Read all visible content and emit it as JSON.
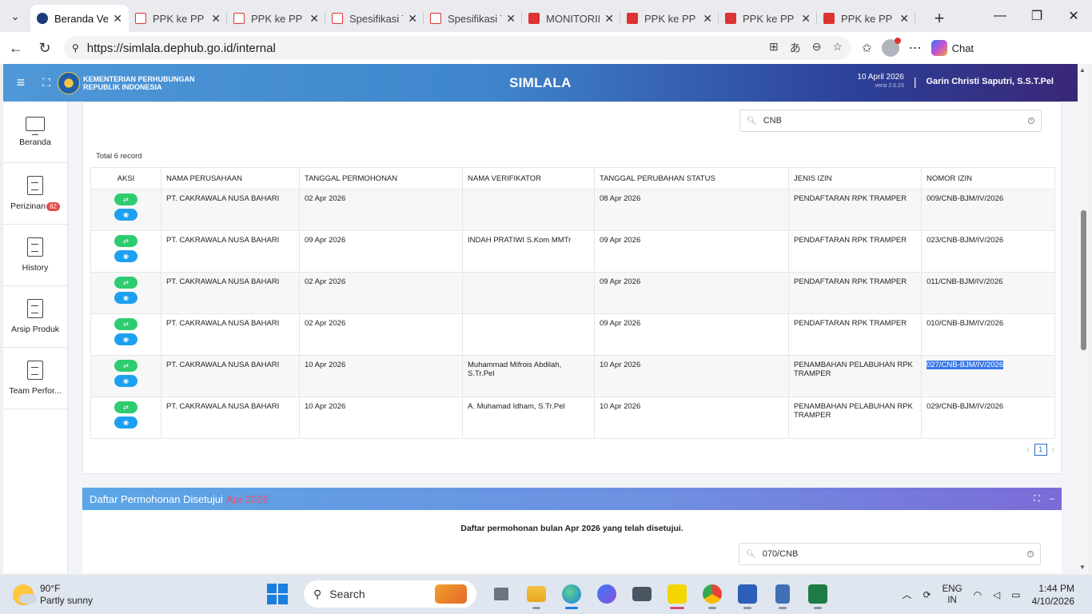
{
  "browser": {
    "tabs": [
      {
        "title": "Beranda Verifikator",
        "icon": "gov",
        "active": true
      },
      {
        "title": "PPK ke PP Pelabuhan",
        "icon": "pdf"
      },
      {
        "title": "PPK ke PP Pelabuhan",
        "icon": "pdf"
      },
      {
        "title": "Spesifikasi Teknis",
        "icon": "pdf"
      },
      {
        "title": "Spesifikasi Teknis",
        "icon": "pdf"
      },
      {
        "title": "MONITORING",
        "icon": "pdf2"
      },
      {
        "title": "PPK ke PP Pelabuhan",
        "icon": "pdf2"
      },
      {
        "title": "PPK ke PP Pelabuhan",
        "icon": "pdf2"
      },
      {
        "title": "PPK ke PP Pelabuhan",
        "icon": "pdf2"
      }
    ],
    "url": "https://simlala.dephub.go.id/internal",
    "chat_label": "Chat"
  },
  "header": {
    "ministry_line1": "KEMENTERIAN PERHUBUNGAN",
    "ministry_line2": "REPUBLIK INDONESIA",
    "app_title": "SIMLALA",
    "date": "10 April 2026",
    "version": "versi 2.0.23",
    "user": "Garin Christi Saputri, S.S.T.Pel"
  },
  "sidebar": {
    "items": [
      {
        "label": "Beranda",
        "icon": "monitor-icon"
      },
      {
        "label": "Perizinan",
        "icon": "document-icon",
        "badge": "82"
      },
      {
        "label": "History",
        "icon": "document-icon"
      },
      {
        "label": "Arsip Produk",
        "icon": "document-icon"
      },
      {
        "label": "Team Perfor...",
        "icon": "document-icon"
      }
    ]
  },
  "list1": {
    "search_value": "CNB",
    "total": "Total 6 record",
    "columns": [
      "AKSI",
      "NAMA PERUSAHAAN",
      "TANGGAL PERMOHONAN",
      "NAMA VERIFIKATOR",
      "TANGGAL PERUBAHAN STATUS",
      "JENIS IZIN",
      "NOMOR IZIN"
    ],
    "rows": [
      {
        "perusahaan": "PT. CAKRAWALA NUSA BAHARI",
        "tgl_permohonan": "02 Apr 2026",
        "verifikator": "",
        "tgl_status": "08 Apr 2026",
        "jenis": "PENDAFTARAN RPK TRAMPER",
        "nomor": "009/CNB-BJM/IV/2026"
      },
      {
        "perusahaan": "PT. CAKRAWALA NUSA BAHARI",
        "tgl_permohonan": "09 Apr 2026",
        "verifikator": "INDAH PRATIWI S.Kom MMTr",
        "tgl_status": "09 Apr 2026",
        "jenis": "PENDAFTARAN RPK TRAMPER",
        "nomor": "023/CNB-BJM/IV/2026"
      },
      {
        "perusahaan": "PT. CAKRAWALA NUSA BAHARI",
        "tgl_permohonan": "02 Apr 2026",
        "verifikator": "",
        "tgl_status": "09 Apr 2026",
        "jenis": "PENDAFTARAN RPK TRAMPER",
        "nomor": "011/CNB-BJM/IV/2026"
      },
      {
        "perusahaan": "PT. CAKRAWALA NUSA BAHARI",
        "tgl_permohonan": "02 Apr 2026",
        "verifikator": "",
        "tgl_status": "09 Apr 2026",
        "jenis": "PENDAFTARAN RPK TRAMPER",
        "nomor": "010/CNB-BJM/IV/2026"
      },
      {
        "perusahaan": "PT. CAKRAWALA NUSA BAHARI",
        "tgl_permohonan": "10 Apr 2026",
        "verifikator": "Muhammad Mifrois Abdilah, S.Tr.Pel",
        "tgl_status": "10 Apr 2026",
        "jenis": "PENAMBAHAN PELABUHAN RPK TRAMPER",
        "nomor": "027/CNB-BJM/IV/2026",
        "selected": true
      },
      {
        "perusahaan": "PT. CAKRAWALA NUSA BAHARI",
        "tgl_permohonan": "10 Apr 2026",
        "verifikator": "A. Muhamad Idham, S.Tr.Pel",
        "tgl_status": "10 Apr 2026",
        "jenis": "PENAMBAHAN PELABUHAN RPK TRAMPER",
        "nomor": "029/CNB-BJM/IV/2026"
      }
    ],
    "page": "1"
  },
  "list2": {
    "title": "Daftar Permohonan Disetujui",
    "month": "Apr 2026",
    "description": "Daftar permohonan bulan Apr 2026 yang telah disetujui.",
    "search_value": "070/CNB"
  },
  "taskbar": {
    "temp": "90°F",
    "weather": "Partly sunny",
    "search_placeholder": "Search",
    "lang1": "ENG",
    "lang2": "IN",
    "time": "1:44 PM",
    "date": "4/10/2026"
  },
  "colors": {
    "accent_green": "#2ecc71",
    "accent_blue": "#1ea0f0",
    "highlight": "#3b78e7",
    "month_red": "#f04f6a"
  }
}
